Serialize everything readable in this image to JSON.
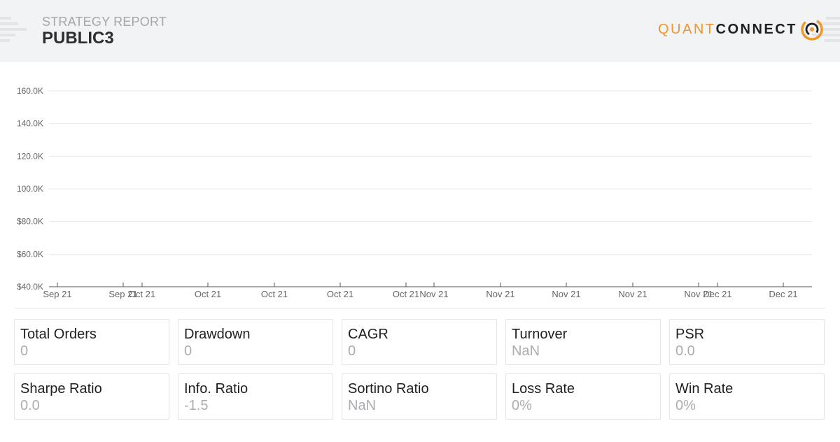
{
  "header": {
    "report_label": "STRATEGY REPORT",
    "title": "PUBLIC3",
    "logo": {
      "quant": "QUANT",
      "connect": "CONNECT",
      "icon": "quantconnect-logo-icon"
    },
    "colors": {
      "background": "#f2f3f5",
      "accent": "#f0962a"
    }
  },
  "chart_data": {
    "type": "line",
    "title": "",
    "xlabel": "",
    "ylabel": "",
    "y_ticks": [
      "160.0K",
      "140.0K",
      "120.0K",
      "100.0K",
      "$80.0K",
      "$60.0K",
      "$40.0K"
    ],
    "y_tick_values": [
      160000,
      140000,
      120000,
      100000,
      80000,
      60000,
      40000
    ],
    "ylim": [
      40000,
      160000
    ],
    "x_ticks": [
      "Sep 21",
      "Sep 21",
      "Oct 21",
      "Oct 21",
      "Oct 21",
      "Oct 21",
      "Oct 21",
      "Nov 21",
      "Nov 21",
      "Nov 21",
      "Nov 21",
      "Nov 21",
      "Dec 21",
      "Dec 21"
    ],
    "series": [],
    "grid": true,
    "colors": {
      "grid": "#e8e9ec",
      "axis": "#555555",
      "tick_text": "#666666"
    }
  },
  "metrics": [
    {
      "label": "Total Orders",
      "value": "0"
    },
    {
      "label": "Drawdown",
      "value": "0"
    },
    {
      "label": "CAGR",
      "value": "0"
    },
    {
      "label": "Turnover",
      "value": "NaN"
    },
    {
      "label": "PSR",
      "value": "0.0"
    },
    {
      "label": "Sharpe Ratio",
      "value": "0.0"
    },
    {
      "label": "Info. Ratio",
      "value": "-1.5"
    },
    {
      "label": "Sortino Ratio",
      "value": "NaN"
    },
    {
      "label": "Loss Rate",
      "value": "0%"
    },
    {
      "label": "Win Rate",
      "value": "0%"
    }
  ]
}
